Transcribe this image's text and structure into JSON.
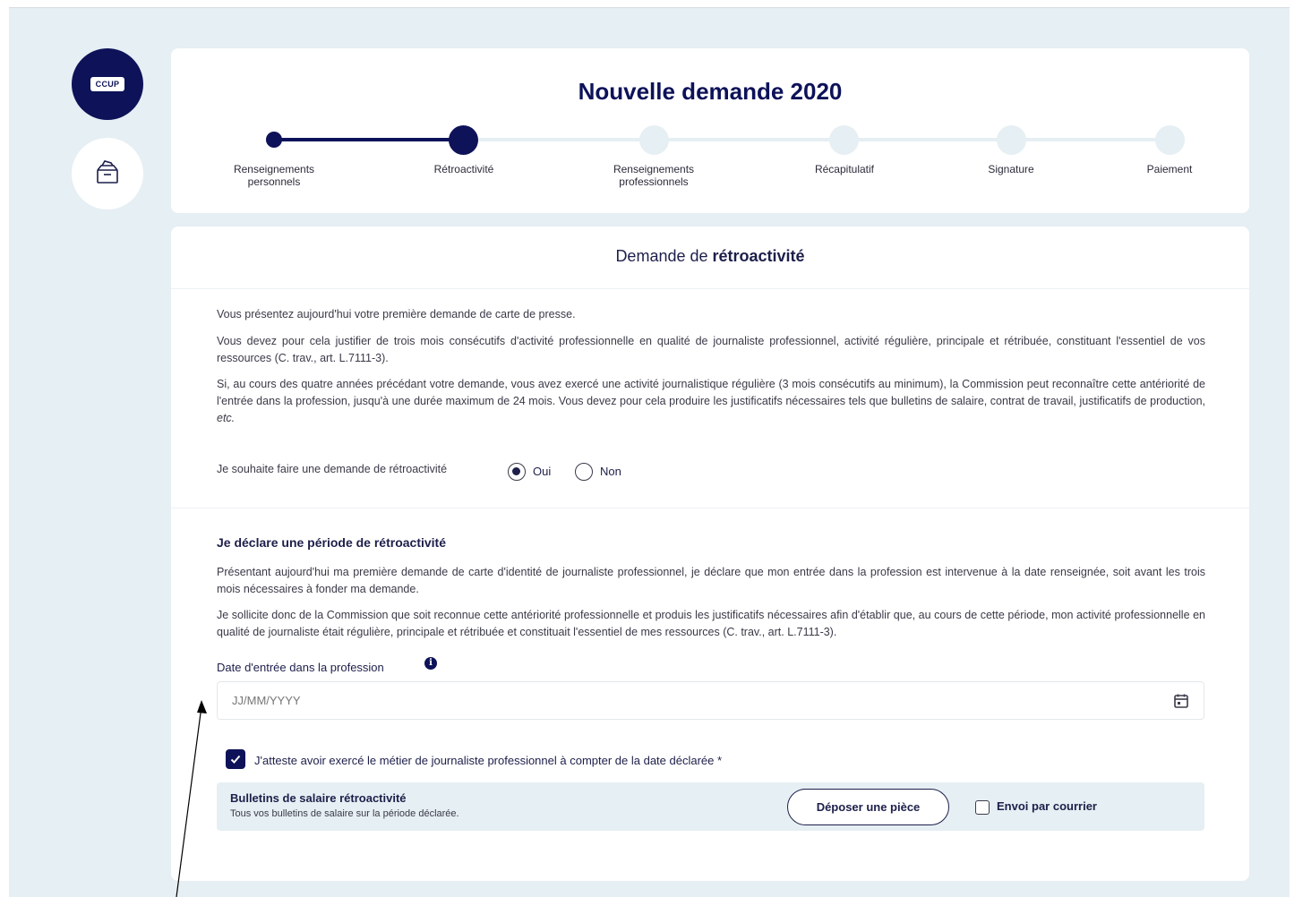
{
  "sidebar": {
    "logo_text": "CCUP",
    "box_icon": "archive-box-icon"
  },
  "header": {
    "title": "Nouvelle demande 2020"
  },
  "steps": [
    {
      "label": "Renseignements personnels",
      "status": "done"
    },
    {
      "label": "Rétroactivité",
      "status": "current"
    },
    {
      "label": "Renseignements professionnels",
      "status": "todo"
    },
    {
      "label": "Récapitulatif",
      "status": "todo"
    },
    {
      "label": "Signature",
      "status": "todo"
    },
    {
      "label": "Paiement",
      "status": "todo"
    }
  ],
  "section": {
    "title_prefix": "Demande de ",
    "title_bold": "rétroactivité",
    "intro": "Vous présentez aujourd'hui votre première demande de carte de presse.",
    "para1": "Vous devez pour cela justifier de trois mois consécutifs d'activité professionnelle en qualité de journaliste professionnel, activité régulière, principale et rétribuée, constituant l'essentiel de vos ressources (C. trav., art. L.7111-3).",
    "para2_main": "Si, au cours des quatre années précédant votre demande, vous avez exercé une activité journalistique régulière (3 mois consécutifs au minimum), la Commission peut reconnaître cette antériorité de l'entrée dans la profession, jusqu'à une durée maximum de 24 mois. Vous devez pour cela produire les justificatifs nécessaires tels que bulletins de salaire, contrat de travail, justificatifs de production, ",
    "para2_etc": "etc."
  },
  "retro_question": {
    "label": "Je souhaite faire une demande de rétroactivité",
    "options": [
      "Oui",
      "Non"
    ],
    "selected": "Oui"
  },
  "declaration": {
    "title": "Je déclare une période de rétroactivité",
    "para1": "Présentant aujourd'hui ma première demande de carte d'identité de journaliste professionnel, je déclare que mon entrée dans la profession est intervenue à la date renseignée, soit avant les trois mois nécessaires à fonder ma demande.",
    "para2": "Je sollicite donc de la Commission que soit reconnue cette antériorité professionnelle et produis les justificatifs nécessaires afin d'établir que, au cours de cette période, mon activité professionnelle en qualité de journaliste était régulière, principale et rétribuée et constituait l'essentiel de mes ressources (C. trav., art. L.7111-3).",
    "date_label": "Date d'entrée dans la profession",
    "date_placeholder": "JJ/MM/YYYY",
    "date_value": "",
    "attest_label": "J'atteste avoir exercé le métier de journaliste professionnel à compter de la date déclarée *",
    "attest_checked": true
  },
  "upload": {
    "title": "Bulletins de salaire rétroactivité",
    "subtitle": "Tous vos bulletins de salaire sur la période déclarée.",
    "button_label": "Déposer une pièce",
    "mail_label": "Envoi par courrier",
    "mail_checked": false
  },
  "colors": {
    "primary": "#0d1259",
    "background": "#e6eff3",
    "inactive_step": "#e6eff3"
  }
}
